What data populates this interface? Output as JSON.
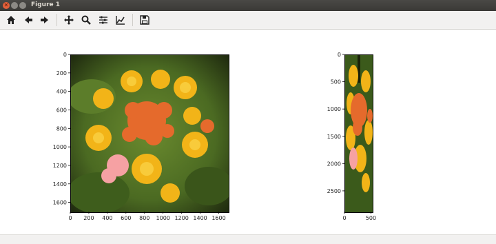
{
  "window": {
    "title": "Figure 1"
  },
  "toolbar": {
    "buttons": [
      {
        "icon": "home-icon"
      },
      {
        "icon": "back-arrow-icon"
      },
      {
        "icon": "forward-arrow-icon"
      },
      {
        "icon": "pan-icon"
      },
      {
        "icon": "zoom-icon"
      },
      {
        "icon": "subplots-config-icon"
      },
      {
        "icon": "edit-axes-icon"
      },
      {
        "icon": "save-icon"
      }
    ]
  },
  "axes": [
    {
      "name": "left-image-axes",
      "x_ticks": [
        "0",
        "200",
        "400",
        "600",
        "800",
        "1000",
        "1200",
        "1400",
        "1600"
      ],
      "y_ticks": [
        "0",
        "200",
        "400",
        "600",
        "800",
        "1000",
        "1200",
        "1400",
        "1600"
      ],
      "xlim": [
        0,
        1700
      ],
      "ylim": [
        1700,
        0
      ]
    },
    {
      "name": "right-image-axes",
      "x_ticks": [
        "0",
        "500"
      ],
      "y_ticks": [
        "0",
        "500",
        "1000",
        "1500",
        "2000",
        "2500"
      ],
      "xlim": [
        0,
        520
      ],
      "ylim": [
        2880,
        0
      ]
    }
  ]
}
